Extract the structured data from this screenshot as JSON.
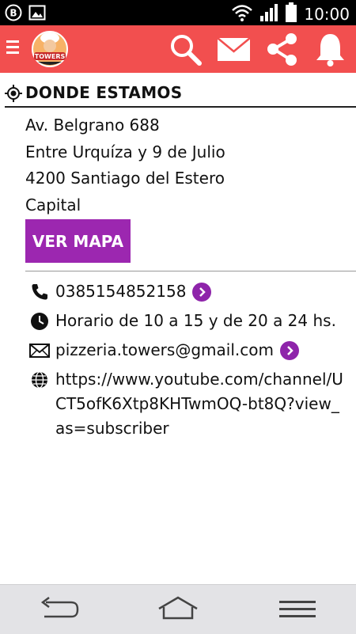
{
  "status_bar": {
    "time": "10:00",
    "icons": [
      "b-notification-icon",
      "image-notification-icon",
      "wifi-icon",
      "signal-icon",
      "battery-icon"
    ]
  },
  "app_bar": {
    "logo_text": "TOWERS",
    "actions": [
      "search-icon",
      "mail-icon",
      "share-icon",
      "bell-icon"
    ],
    "color": "#f24f4f"
  },
  "location": {
    "title": "DONDE ESTAMOS",
    "address_lines": [
      "Av. Belgrano 688",
      "Entre Urquíza y 9 de Julio",
      "4200 Santiago del Estero",
      "Capital"
    ],
    "map_button": "VER MAPA",
    "button_color": "#9c27b0"
  },
  "contact": {
    "phone": "0385154852158",
    "hours": "Horario de 10 a 15  y de 20 a 24 hs.",
    "email": "pizzeria.towers@gmail.com",
    "website": "https://www.youtube.com/channel/UCT5ofK6Xtp8KHTwmOQ-bt8Q?view_as=subscriber"
  },
  "nav_bar": {
    "buttons": [
      "back-icon",
      "home-icon",
      "menu-icon"
    ]
  }
}
